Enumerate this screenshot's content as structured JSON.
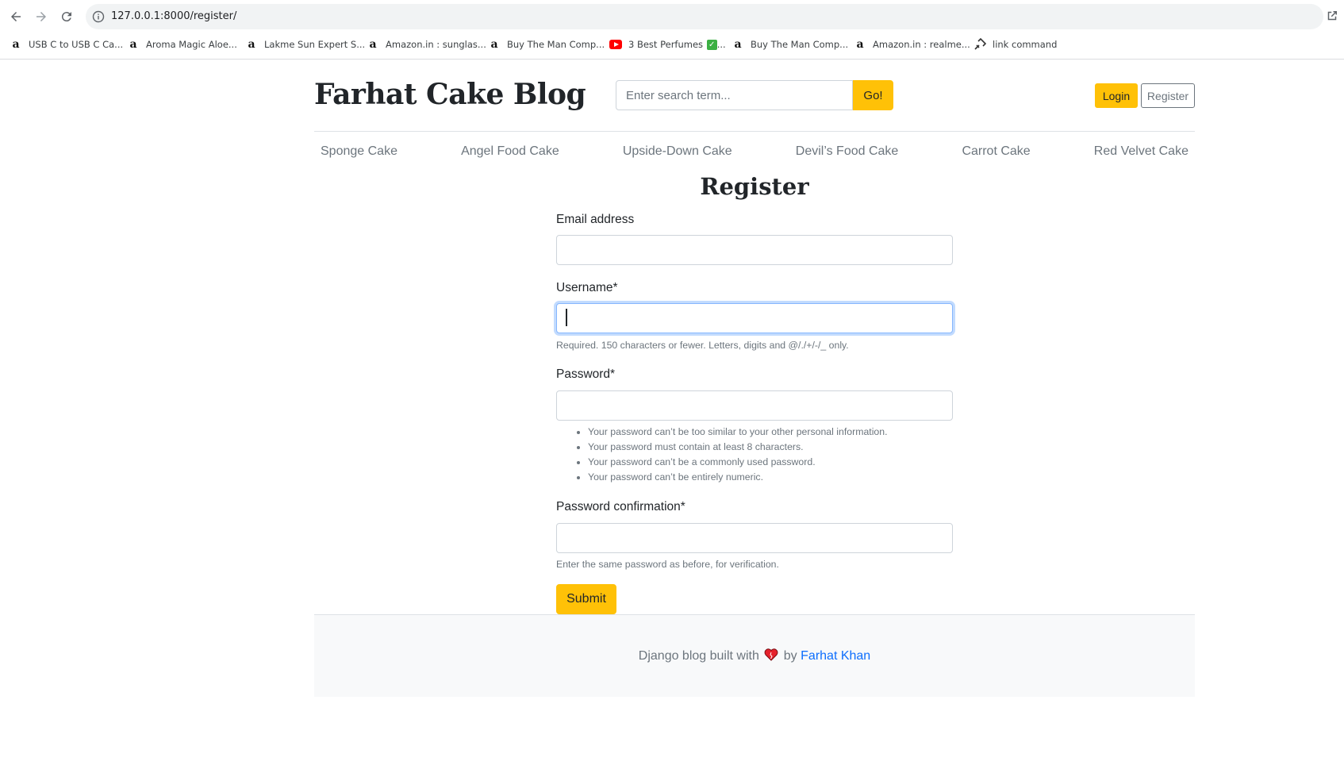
{
  "browser": {
    "url": "127.0.0.1:8000/register/",
    "bookmarks": [
      {
        "label": "USB C to USB C Ca...",
        "icon": "amazon-icon"
      },
      {
        "label": "Aroma Magic Aloe...",
        "icon": "amazon-icon"
      },
      {
        "label": "Lakme Sun Expert S...",
        "icon": "amazon-icon"
      },
      {
        "label": "Amazon.in : sunglas...",
        "icon": "amazon-icon"
      },
      {
        "label": "Buy The Man Comp...",
        "icon": "amazon-icon"
      },
      {
        "label": "3 Best Perfumes",
        "suffix": "...",
        "icon": "youtube-icon"
      },
      {
        "label": "Buy The Man Comp...",
        "icon": "amazon-icon"
      },
      {
        "label": "Amazon.in : realme...",
        "icon": "amazon-icon"
      },
      {
        "label": "link command",
        "icon": "link-command-icon"
      }
    ]
  },
  "header": {
    "brand": "Farhat Cake Blog",
    "search_placeholder": "Enter search term...",
    "search_button": "Go!",
    "login_button": "Login",
    "register_button": "Register"
  },
  "categories": [
    "Sponge Cake",
    "Angel Food Cake",
    "Upside-Down Cake",
    "Devil’s Food Cake",
    "Carrot Cake",
    "Red Velvet Cake"
  ],
  "form": {
    "title": "Register",
    "email_label": "Email address",
    "email_value": "",
    "username_label": "Username*",
    "username_value": "",
    "username_help": "Required. 150 characters or fewer. Letters, digits and @/./+/-/_ only.",
    "password_label": "Password*",
    "password_value": "",
    "password_rules": [
      "Your password can’t be too similar to your other personal information.",
      "Your password must contain at least 8 characters.",
      "Your password can’t be a commonly used password.",
      "Your password can’t be entirely numeric."
    ],
    "confirm_label": "Password confirmation*",
    "confirm_value": "",
    "confirm_help": "Enter the same password as before, for verification.",
    "submit": "Submit"
  },
  "footer": {
    "text_before": "Django blog built with",
    "text_by": "by",
    "author": "Farhat Khan"
  },
  "colors": {
    "accent": "#ffc107",
    "link": "#0d6efd",
    "muted": "#6c757d"
  }
}
